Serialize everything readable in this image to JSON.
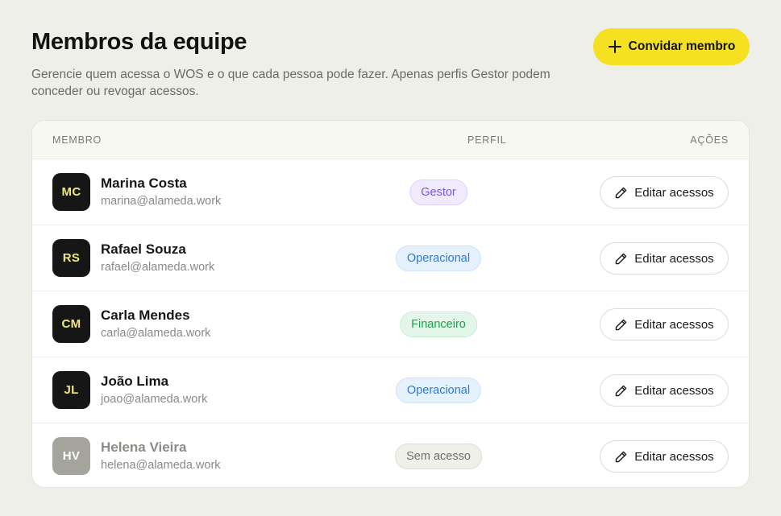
{
  "header": {
    "title": "Membros da equipe",
    "subtitle": "Gerencie quem acessa o WOS e o que cada pessoa pode fazer. Apenas perfis Gestor podem conceder ou revogar acessos.",
    "invite_label": "Convidar membro"
  },
  "table": {
    "columns": {
      "member": "MEMBRO",
      "profile": "PERFIL",
      "actions": "AÇÕES"
    },
    "edit_label": "Editar acessos",
    "rows": [
      {
        "initials": "MC",
        "name": "Marina Costa",
        "email": "marina@alameda.work",
        "profile": "Gestor"
      },
      {
        "initials": "RS",
        "name": "Rafael Souza",
        "email": "rafael@alameda.work",
        "profile": "Operacional"
      },
      {
        "initials": "CM",
        "name": "Carla Mendes",
        "email": "carla@alameda.work",
        "profile": "Financeiro"
      },
      {
        "initials": "JL",
        "name": "João Lima",
        "email": "joao@alameda.work",
        "profile": "Operacional"
      },
      {
        "initials": "HV",
        "name": "Helena Vieira",
        "email": "helena@alameda.work",
        "profile": "Sem acesso"
      }
    ]
  },
  "icons": {
    "invite": "plus-icon",
    "edit": "pencil-icon"
  },
  "colors": {
    "accent": "#f5e022",
    "gestor": "#7a55e6",
    "operacional": "#2f78d6",
    "financeiro": "#1e9e4f",
    "sem_acesso": "#6e6e68"
  }
}
